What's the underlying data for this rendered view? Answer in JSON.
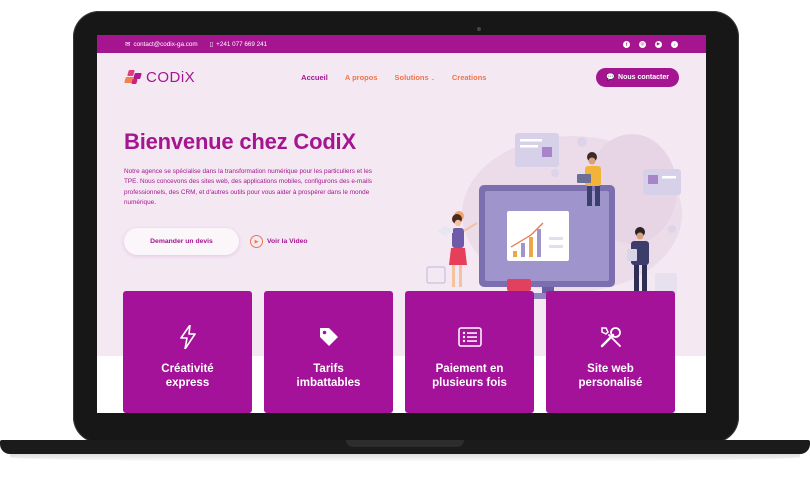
{
  "topbar": {
    "email": "contact@codix-ga.com",
    "phone": "+241 077 669 241",
    "socials": [
      {
        "icon": "facebook-icon",
        "glyph": "f"
      },
      {
        "icon": "instagram-icon",
        "glyph": "◎"
      },
      {
        "icon": "youtube-icon",
        "glyph": "▶"
      },
      {
        "icon": "tiktok-icon",
        "glyph": "♪"
      }
    ]
  },
  "nav": {
    "logo_text": "CODiX",
    "items": [
      "Accueil",
      "A propos",
      "Solutions",
      "Creations"
    ],
    "active": "Accueil",
    "cta": "Nous contacter"
  },
  "hero": {
    "title": "Bienvenue chez CodiX",
    "text": "Notre agence se spécialise dans la transformation numérique pour les particuliers et les TPE. Nous concevons des sites web, des applications mobiles, configurons des e-mails professionnels, des CRM, et d'autres outils pour vous aider à prospérer dans le monde numérique.",
    "quote_button": "Demander un devis",
    "video_link": "Voir la Video"
  },
  "features": [
    {
      "icon": "lightning-icon",
      "label": "Créativité\nexpress"
    },
    {
      "icon": "price-tag-icon",
      "label": "Tarifs\nimbattables"
    },
    {
      "icon": "list-icon",
      "label": "Paiement en\nplusieurs fois"
    },
    {
      "icon": "tools-icon",
      "label": "Site web\npersonalisé"
    }
  ],
  "colors": {
    "brand": "#a5158f",
    "accent": "#f0744a",
    "background": "#f4e9f3"
  }
}
